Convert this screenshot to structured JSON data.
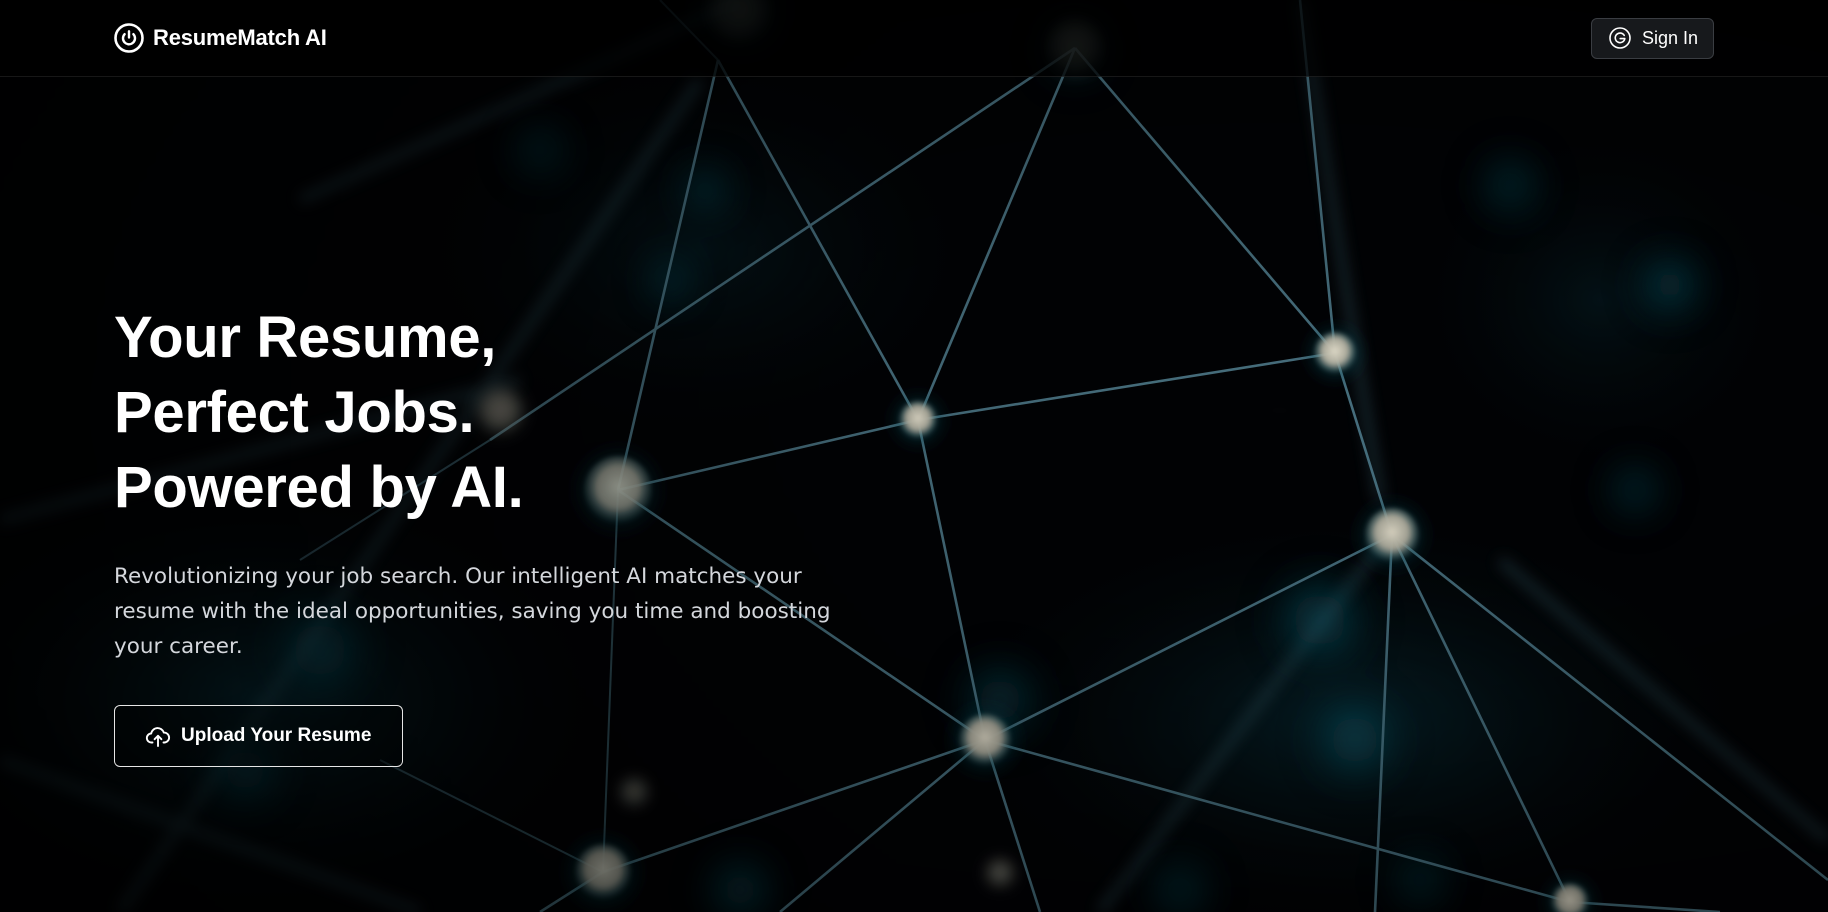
{
  "header": {
    "brand_name": "ResumeMatch AI",
    "brand_icon": "power-icon",
    "signin_label": "Sign In",
    "signin_icon": "google-icon"
  },
  "hero": {
    "title_lines": [
      "Your Resume,",
      "Perfect Jobs.",
      "Powered by AI."
    ],
    "subtitle": "Revolutionizing your job search. Our intelligent AI matches your resume with the ideal opportunities, saving you time and boosting your career.",
    "cta_label": "Upload Your Resume",
    "cta_icon": "cloud-upload-icon"
  },
  "colors": {
    "background": "#000000",
    "network_line": "#4f7c8c",
    "network_node": "#c9c6b8",
    "glow": "#0f6b82",
    "text_primary": "#ffffff",
    "text_secondary": "#d4d7dc"
  }
}
